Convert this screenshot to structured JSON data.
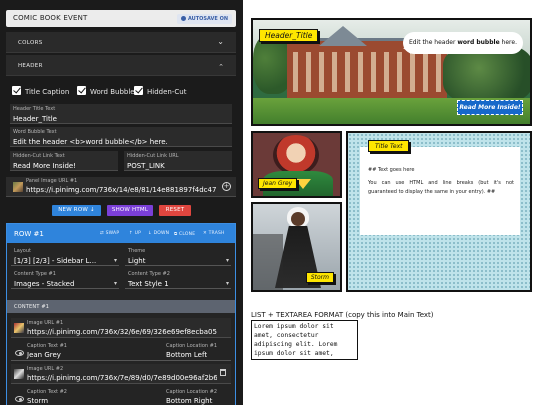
{
  "app": {
    "title": "COMIC BOOK EVENT",
    "autosave": "AUTOSAVE ON"
  },
  "sections": {
    "colors": "COLORS",
    "header": "HEADER"
  },
  "header_options": {
    "title_caption": "Title Caption",
    "word_bubble": "Word Bubble",
    "hidden_cut": "Hidden-Cut"
  },
  "header_fields": {
    "title_text_label": "Header Title Text",
    "title_text_value": "Header_Title",
    "bubble_label": "Word Bubble Text",
    "bubble_value": "Edit the header <b>word bubble</b> here.",
    "cut_text_label": "Hidden-Cut Link Text",
    "cut_text_value": "Read More Inside!",
    "cut_url_label": "Hidden-Cut Link URL",
    "cut_url_value": "POST_LINK",
    "image_url_label": "Panel Image URL #1",
    "image_url_value": "https://i.pinimg.com/736x/14/e8/81/14e881897f4dc47"
  },
  "buttons": {
    "new_row": "NEW ROW ↓",
    "show_html": "SHOW HTML",
    "reset": "RESET"
  },
  "row": {
    "title": "ROW #1",
    "actions": [
      "⇄ SWAP",
      "↑ UP",
      "↓ DOWN",
      "⧉ CLONE",
      "✕ TRASH"
    ],
    "layout_label": "Layout",
    "layout_value": "[1/3] [2/3] - Sidebar L...",
    "theme_label": "Theme",
    "theme_value": "Light",
    "ct1_label": "Content Type #1",
    "ct1_value": "Images - Stacked",
    "ct2_label": "Content Type #2",
    "ct2_value": "Text Style 1",
    "content_bar": "CONTENT #1",
    "img1_label": "Image URL #1",
    "img1_value": "https://i.pinimg.com/736x/32/6e/69/326e69ef8ecba05",
    "cap1_label": "Caption Text #1",
    "cap1_value": "Jean Grey",
    "loc1_label": "Caption Location #1",
    "loc1_value": "Bottom Left",
    "img2_label": "Image URL #2",
    "img2_value": "https://i.pinimg.com/736x/7e/89/d0/7e89d00e96af2b6",
    "cap2_label": "Caption Text #2",
    "cap2_value": "Storm",
    "loc2_label": "Caption Location #2",
    "loc2_value": "Bottom Right"
  },
  "preview": {
    "header_title": "Header_Title",
    "bubble_plain": "Edit the header ",
    "bubble_bold": "word bubble",
    "bubble_end": " here.",
    "read_more": "Read More Inside!",
    "jean_caption": "Jean Grey",
    "storm_caption": "Storm",
    "text_title": "Title Text",
    "text_line1": "## Text goes here",
    "text_line2": "You can use HTML and line breaks (but it's not guaranteed to display the same in your entry). ##"
  },
  "list_format": {
    "label": "LIST + TEXTAREA FORMAT (copy this into Main Text)",
    "text": "Lorem ipsum dolor sit amet, consectetur adipiscing elit. Lorem ipsum dolor sit amet,"
  },
  "colors": {
    "accent": "#2f84dc",
    "show_html": "#7b3fd8",
    "reset": "#e0463f",
    "caption_yellow": "#ffe600"
  }
}
